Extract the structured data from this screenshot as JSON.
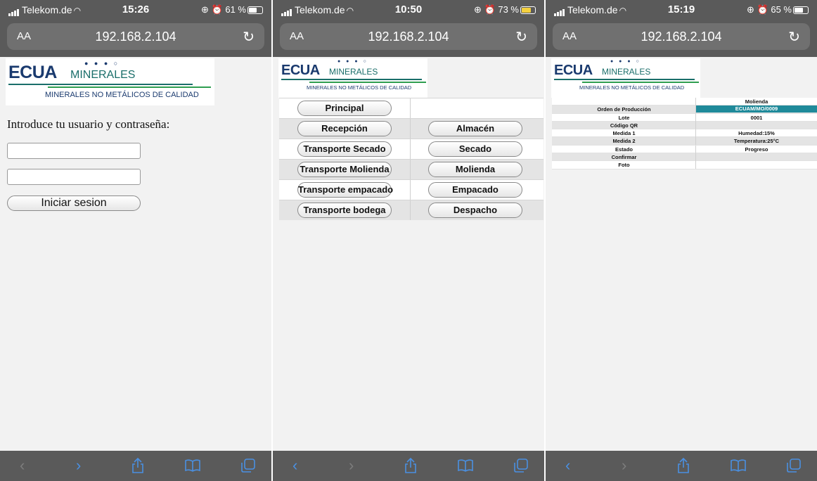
{
  "screens": [
    {
      "status": {
        "carrier": "Telekom.de",
        "time": "15:26",
        "battery": "61 %",
        "battery_level": 0.61,
        "charging": false
      },
      "browser": {
        "aa": "AA",
        "url": "192.168.2.104"
      },
      "logo": {
        "brand": "ECUA",
        "brand2": "MINERALES",
        "dots": "● ● ● ○",
        "slogan": "MINERALES NO METÁLICOS DE CALIDAD"
      },
      "login": {
        "title": "Introduce tu usuario y contraseña:",
        "user_value": "",
        "password_value": "",
        "submit": "Iniciar sesion"
      },
      "toolbar": {
        "back_enabled": false,
        "forward_enabled": true
      }
    },
    {
      "status": {
        "carrier": "Telekom.de",
        "time": "10:50",
        "battery": "73 %",
        "battery_level": 0.73,
        "charging": true
      },
      "browser": {
        "aa": "AA",
        "url": "192.168.2.104"
      },
      "logo": {
        "brand": "ECUA",
        "brand2": "MINERALES",
        "dots": "● ● ● ○",
        "slogan": "MINERALES NO METÁLICOS DE CALIDAD"
      },
      "menu": [
        {
          "left": "Principal",
          "right": ""
        },
        {
          "left": "Recepción",
          "right": "Almacén"
        },
        {
          "left": "Transporte Secado",
          "right": "Secado"
        },
        {
          "left": "Transporte Molienda",
          "right": "Molienda"
        },
        {
          "left": "Transporte empacado",
          "right": "Empacado"
        },
        {
          "left": "Transporte bodega",
          "right": "Despacho"
        }
      ],
      "toolbar": {
        "back_enabled": true,
        "forward_enabled": false
      }
    },
    {
      "status": {
        "carrier": "Telekom.de",
        "time": "15:19",
        "battery": "65 %",
        "battery_level": 0.65,
        "charging": false
      },
      "browser": {
        "aa": "AA",
        "url": "192.168.2.104"
      },
      "logo": {
        "brand": "ECUA",
        "brand2": "MINERALES",
        "dots": "● ● ● ○",
        "slogan": "MINERALES NO METÁLICOS DE CALIDAD"
      },
      "detail": {
        "header": "Molienda",
        "rows": [
          {
            "label": "Orden de Producción",
            "value": "ECUAM/MO/0009",
            "highlight": true
          },
          {
            "label": "Lote",
            "value": "0001"
          },
          {
            "label": "Código QR",
            "value": ""
          },
          {
            "label": "Medida 1",
            "value": "Humedad:15%"
          },
          {
            "label": "Medida 2",
            "value": "Temperatura:25°C"
          },
          {
            "label": "Estado",
            "value": "Progreso"
          },
          {
            "label": "Confirmar",
            "value": ""
          },
          {
            "label": "Foto",
            "value": ""
          }
        ]
      },
      "toolbar": {
        "back_enabled": true,
        "forward_enabled": false
      }
    }
  ],
  "colors": {
    "chrome": "#5a5a5a",
    "url_field": "#707070",
    "toolbar_active": "#4a90e2",
    "toolbar_inactive": "#7d7d7d",
    "highlight": "#1f8a9a",
    "logo_navy": "#1a3a6e",
    "logo_teal": "#1a6e6a",
    "logo_green": "#2e9e50"
  },
  "icons": {
    "wifi": "wifi-icon",
    "alarm": "alarm-icon",
    "rotation_lock": "rotation-lock-icon",
    "reload": "reload-icon",
    "back": "chevron-left-icon",
    "forward": "chevron-right-icon",
    "share": "share-icon",
    "bookmarks": "book-icon",
    "tabs": "tabs-icon"
  }
}
